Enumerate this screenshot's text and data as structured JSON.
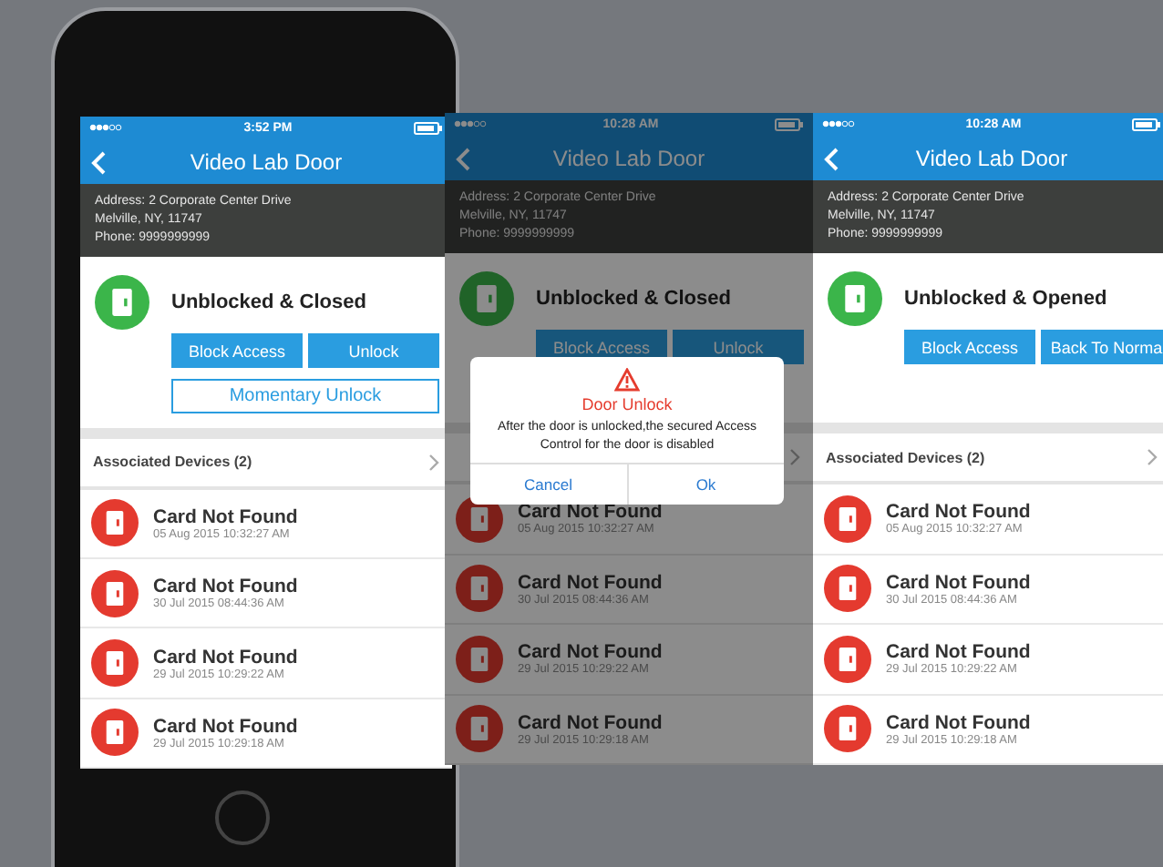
{
  "screens": [
    {
      "status_time": "3:52 PM",
      "title": "Video Lab Door",
      "address_lines": [
        "Address: 2 Corporate Center Drive",
        "Melville, NY, 11747",
        "Phone: 9999999999"
      ],
      "door_state": "Unblocked & Closed",
      "actions": [
        {
          "label": "Block Access",
          "kind": "filled"
        },
        {
          "label": "Unlock",
          "kind": "filled"
        },
        {
          "label": "Momentary Unlock",
          "kind": "outline"
        }
      ],
      "devices_label": "Associated Devices (2)",
      "events": [
        {
          "title": "Card Not Found",
          "time": "05 Aug 2015 10:32:27 AM"
        },
        {
          "title": "Card Not Found",
          "time": "30 Jul 2015 08:44:36 AM"
        },
        {
          "title": "Card Not Found",
          "time": "29 Jul 2015 10:29:22 AM"
        },
        {
          "title": "Card Not Found",
          "time": "29 Jul 2015 10:29:18 AM"
        }
      ]
    },
    {
      "status_time": "10:28 AM",
      "title": "Video Lab Door",
      "address_lines": [
        "Address: 2 Corporate Center Drive",
        "Melville, NY, 11747",
        "Phone: 9999999999"
      ],
      "door_state": "Unblocked & Closed",
      "actions": [
        {
          "label": "Block Access",
          "kind": "filled"
        },
        {
          "label": "Unlock",
          "kind": "filled"
        }
      ],
      "events": [
        {
          "title": "Card Not Found",
          "time": "05 Aug 2015 10:32:27 AM"
        },
        {
          "title": "Card Not Found",
          "time": "30 Jul 2015 08:44:36 AM"
        },
        {
          "title": "Card Not Found",
          "time": "29 Jul 2015 10:29:22 AM"
        },
        {
          "title": "Card Not Found",
          "time": "29 Jul 2015 10:29:18 AM"
        }
      ],
      "dialog": {
        "title": "Door Unlock",
        "message": "After the door is unlocked,the secured Access Control for the door is disabled",
        "buttons": [
          "Cancel",
          "Ok"
        ]
      }
    },
    {
      "status_time": "10:28 AM",
      "title": "Video Lab Door",
      "address_lines": [
        "Address: 2 Corporate Center Drive",
        "Melville, NY, 11747",
        "Phone: 9999999999"
      ],
      "door_state": "Unblocked & Opened",
      "actions": [
        {
          "label": "Block Access",
          "kind": "filled"
        },
        {
          "label": "Back To Norma",
          "kind": "filled"
        }
      ],
      "devices_label": "Associated Devices (2)",
      "events": [
        {
          "title": "Card Not Found",
          "time": "05 Aug 2015 10:32:27 AM"
        },
        {
          "title": "Card Not Found",
          "time": "30 Jul 2015 08:44:36 AM"
        },
        {
          "title": "Card Not Found",
          "time": "29 Jul 2015 10:29:22 AM"
        },
        {
          "title": "Card Not Found",
          "time": "29 Jul 2015 10:29:18 AM"
        }
      ]
    }
  ]
}
